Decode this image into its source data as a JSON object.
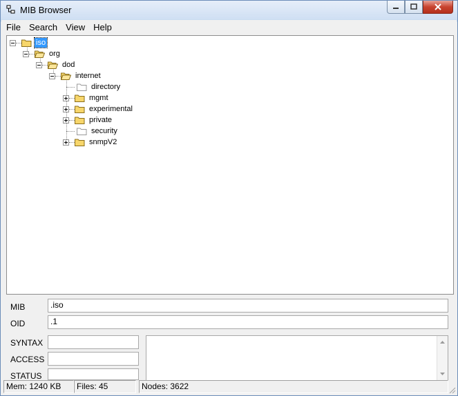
{
  "window": {
    "title": "MIB Browser"
  },
  "menu": [
    "File",
    "Search",
    "View",
    "Help"
  ],
  "tree": {
    "root": "iso",
    "org": "org",
    "dod": "dod",
    "internet": "internet",
    "children": [
      {
        "label": "directory",
        "expandable": false
      },
      {
        "label": "mgmt",
        "expandable": true
      },
      {
        "label": "experimental",
        "expandable": true
      },
      {
        "label": "private",
        "expandable": true
      },
      {
        "label": "security",
        "expandable": false
      },
      {
        "label": "snmpV2",
        "expandable": true
      }
    ]
  },
  "details": {
    "mib_label": "MIB",
    "mib_value": ".iso",
    "oid_label": "OID",
    "oid_value": ".1",
    "syntax_label": "SYNTAX",
    "syntax_value": "",
    "access_label": "ACCESS",
    "access_value": "",
    "status_label": "STATUS",
    "status_value": ""
  },
  "status": {
    "mem": "Mem: 1240 KB",
    "files": "Files: 45",
    "nodes": "Nodes: 3622"
  },
  "colors": {
    "selection": "#3399ff",
    "folder": "#f7d66b"
  }
}
